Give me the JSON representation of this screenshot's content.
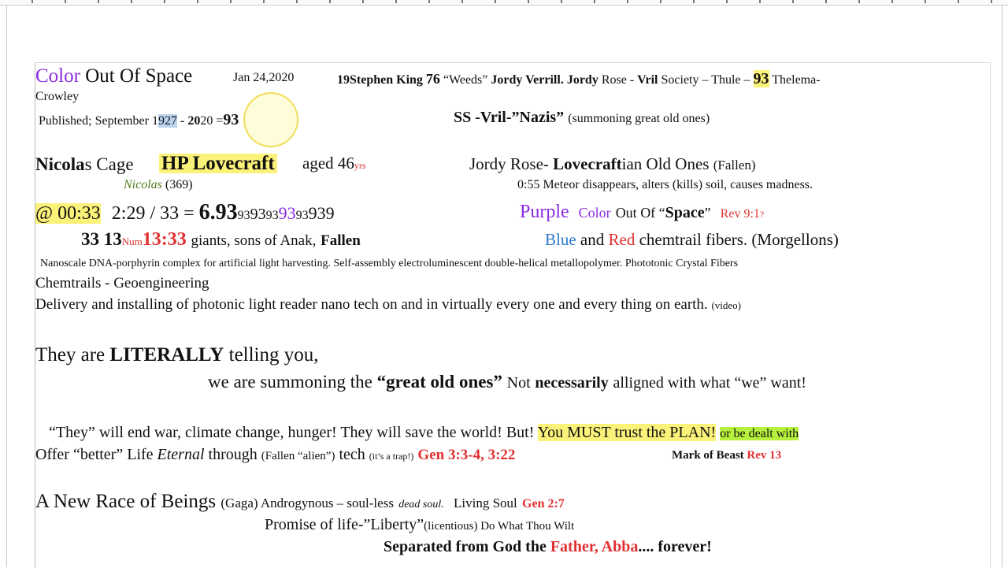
{
  "line1": {
    "title_color": "Color",
    "title_rest": "Out Of Space",
    "date": "Jan 24,2020",
    "sk_num": "19",
    "sk_name": "Stephen King",
    "sk_76": "76",
    "weeds": "“Weeds”",
    "jv": "Jordy Verrill.",
    "jordy": "Jordy",
    "rose": "Rose -",
    "vril": "Vril",
    "society": "Society – Thule –",
    "n93": "93",
    "thelema": "Thelema-",
    "crowley": "Crowley"
  },
  "line2": {
    "pub": "Published; September 1",
    "sel": "927",
    "mid": " - 20",
    "mid2": "2",
    "mid3": "0 =",
    "n93": "93",
    "ss": "SS -Vril-”Nazis”",
    "summon": "(summoning great old ones)"
  },
  "line3": {
    "nicola": "Nicola",
    "s_cage": "s Cage",
    "hp": "HP Lovecraft",
    "aged": "aged 46",
    "yrs": "yrs",
    "jordy_rose": "Jordy Rose-",
    "lovecraft": "Lovecraft",
    "ian": "ian Old Ones",
    "fallen": "(Fallen)"
  },
  "line4": {
    "nicolas": "Nicolas",
    "n369": "(369)",
    "meteor": "0:55 Meteor disappears, alters (kills) soil, causes madness."
  },
  "line5": {
    "at": "@ 00:33",
    "calc": "2:29 / 33 =",
    "big": "6.93",
    "s1": "93",
    "s2": "93",
    "s3": "93",
    "s4": "93",
    "s5": "93",
    "s6": "939",
    "purple": "Purple",
    "color": "Color",
    "out_of": "Out Of “",
    "space": "Space",
    "close_q": "”",
    "rev": "Rev 9:1",
    "q": "?"
  },
  "line6": {
    "n33": "33",
    "n13": "13",
    "num": "Num",
    "ref": "13:33",
    "giants": "giants, sons of Anak,",
    "fallen": "Fallen",
    "blue": "Blue",
    "and": "and",
    "red": "Red",
    "chem": "chemtrail fibers. (Morgellons)"
  },
  "line7": "Nanoscale DNA-porphyrin complex for artificial light harvesting.  Self-assembly electroluminescent double-helical metallopolymer.  Phototonic Crystal Fibers",
  "line8": "Chemtrails - Geoengineering",
  "line9": {
    "text": "Delivery and installing of photonic light reader nano tech on and in virtually every one and every thing on earth.",
    "video": "(video)"
  },
  "line10": {
    "a": "They are",
    "b": "LITERALLY",
    "c": "telling you,"
  },
  "line11": {
    "a": "we are summoning the",
    "b": "“great old ones”",
    "c": "Not",
    "d": "necessarily",
    "e": "alligned with what “we” want!"
  },
  "line12": {
    "a": "“They” will end war, climate change, hunger! They will save the world! But!",
    "b": "You MUST trust the PLAN!",
    "c": "or be dealt with"
  },
  "line13": {
    "a": "Offer “better” Life",
    "eternal": "Eternal",
    "through": "through",
    "fallen": "(Fallen “alien”)",
    "tech": "tech",
    "trap": "(it’s a trap!)",
    "gen": "Gen 3:3-4, 3:22",
    "mark": "Mark of Beast",
    "rev13": "Rev 13"
  },
  "line14": {
    "a": "A New Race of Beings",
    "gaga": "(Gaga) Androgynous – soul-less",
    "dead": "dead soul.",
    "living": "Living Soul",
    "gen": "Gen 2:7"
  },
  "line15": {
    "a": "Promise of life-”Liberty”",
    "b": "(licentious) Do What Thou Wilt"
  },
  "line16": {
    "a": "Separated from God the",
    "b": "Father, Abba",
    "c": ".... forever!"
  }
}
